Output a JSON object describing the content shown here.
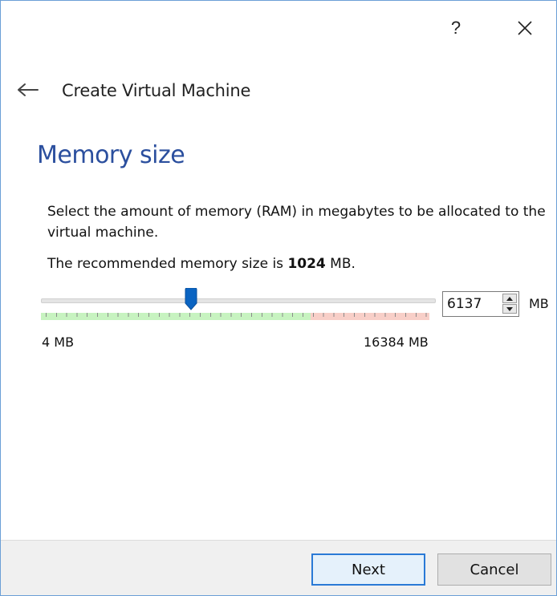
{
  "window": {
    "help_label": "?"
  },
  "header": {
    "title": "Create Virtual Machine"
  },
  "page": {
    "heading": "Memory size",
    "description": "Select the amount of memory (RAM) in megabytes to be allocated to the virtual machine.",
    "recommend_prefix": "The recommended memory size is",
    "recommend_value": "1024",
    "recommend_unit": "MB."
  },
  "memory": {
    "value": "6137",
    "unit": "MB",
    "min_label": "4 MB",
    "max_label": "16384 MB",
    "min": 4,
    "max": 16384,
    "current": 6137,
    "recommended": 1024
  },
  "buttons": {
    "next": "Next",
    "cancel": "Cancel"
  },
  "colors": {
    "heading": "#2b4f9e",
    "accent": "#0067c0",
    "ruler_safe": "#c7f3c0",
    "ruler_danger": "#f8cfc8"
  },
  "icons": {
    "back": "back-arrow-icon",
    "close": "close-icon",
    "spin_up": "spin-up-icon",
    "spin_down": "spin-down-icon"
  }
}
